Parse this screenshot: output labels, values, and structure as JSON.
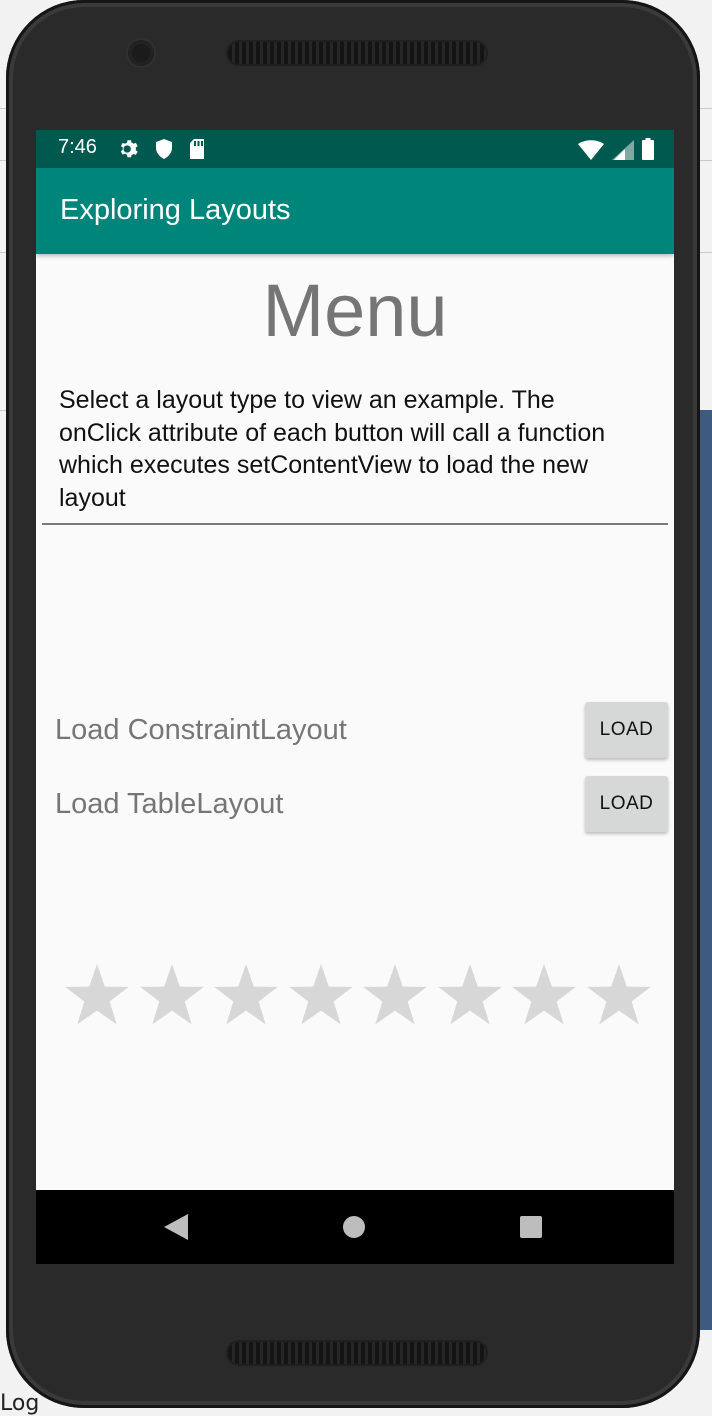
{
  "background": {
    "log_label": "Log"
  },
  "status_bar": {
    "time": "7:46",
    "left_icons": [
      "gear-icon",
      "shield-icon",
      "sd-card-icon"
    ],
    "right_icons": [
      "wifi-icon",
      "cell-signal-icon",
      "battery-icon"
    ]
  },
  "app_bar": {
    "title": "Exploring Layouts"
  },
  "content": {
    "heading": "Menu",
    "description": "Select a layout type to view an example. The onClick attribute of each button will call a function which executes setContentView to load the new layout",
    "rows": [
      {
        "label": "Load ConstraintLayout",
        "button": "LOAD"
      },
      {
        "label": "Load TableLayout",
        "button": "LOAD"
      }
    ],
    "rating": {
      "total_stars": 8,
      "filled_stars": 0
    }
  },
  "nav_bar": {
    "buttons": [
      "back-icon",
      "home-icon",
      "recents-icon"
    ]
  },
  "colors": {
    "status_bar": "#00594e",
    "app_bar": "#00857a",
    "screen_bg": "#fafafa",
    "star_empty": "#d7d7d7",
    "button_bg": "#d6d7d7"
  }
}
